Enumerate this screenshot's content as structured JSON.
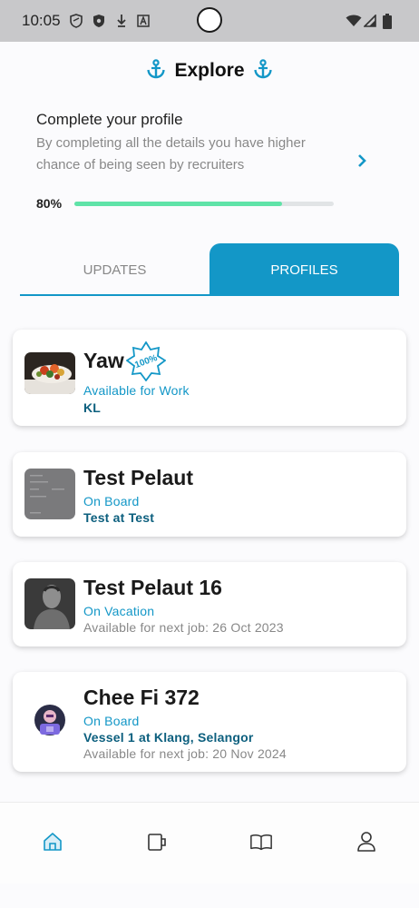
{
  "status_bar": {
    "time": "10:05"
  },
  "header": {
    "title": "Explore",
    "icon": "anchor-icon"
  },
  "profile_completion": {
    "title": "Complete your profile",
    "description": "By completing all the details you have higher chance of being seen by recruiters",
    "progress_label": "80%",
    "progress_fraction": 0.8
  },
  "tabs": [
    {
      "label": "UPDATES",
      "active": false
    },
    {
      "label": "PROFILES",
      "active": true
    }
  ],
  "profiles": [
    {
      "name": "Yaw",
      "badge": "100%",
      "status": "Available for Work",
      "location": "KL",
      "extra": ""
    },
    {
      "name": "Test Pelaut",
      "status": "On Board",
      "location": "Test at Test",
      "extra": ""
    },
    {
      "name": "Test Pelaut 16",
      "status": "On Vacation",
      "location": "",
      "extra": "Available for next job: 26 Oct 2023"
    },
    {
      "name": "Chee Fi 372",
      "status": "On Board",
      "location": "Vessel 1 at Klang, Selangor",
      "extra": "Available for next job: 20 Nov 2024"
    }
  ],
  "bottom_nav": [
    {
      "icon": "home-icon",
      "active": true
    },
    {
      "icon": "mug-icon",
      "active": false
    },
    {
      "icon": "book-icon",
      "active": false
    },
    {
      "icon": "user-icon",
      "active": false
    }
  ],
  "colors": {
    "accent": "#1397c7",
    "progress": "#5fe3a8",
    "dark_teal": "#0c5f7e"
  }
}
